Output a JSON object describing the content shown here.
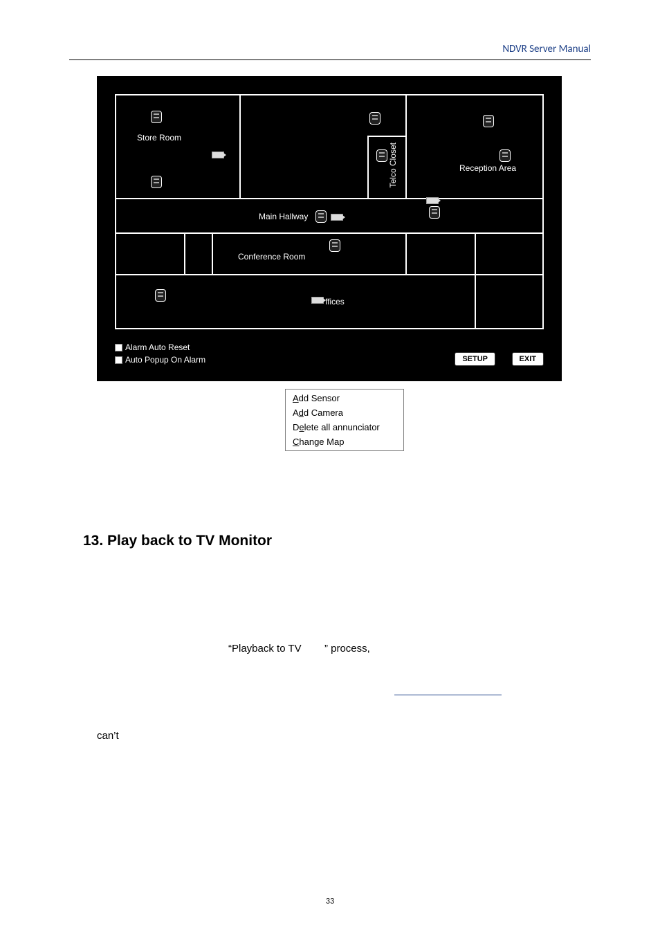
{
  "header": {
    "title": "NDVR Server Manual"
  },
  "map": {
    "rooms": {
      "store": "Store Room",
      "telco": "Telco Closet",
      "reception": "Reception Area",
      "hallway": "Main Hallway",
      "conference": "Conference Room",
      "offices": "ffices"
    },
    "checkboxes": {
      "auto_reset": "Alarm Auto Reset",
      "auto_popup": "Auto Popup On Alarm"
    },
    "buttons": {
      "setup": "SETUP",
      "exit": "EXIT"
    }
  },
  "context_menu": {
    "add_sensor": {
      "pre": "",
      "u": "A",
      "post": "dd Sensor"
    },
    "add_camera": {
      "pre": "A",
      "u": "d",
      "post": "d Camera"
    },
    "delete_all": {
      "pre": "D",
      "u": "e",
      "post": "lete all annunciator"
    },
    "change_map": {
      "pre": "",
      "u": "C",
      "post": "hange Map"
    }
  },
  "section": {
    "heading": "13. Play back to TV Monitor",
    "line1_a": "“Playback to TV",
    "line1_b": "” process,",
    "line2": "can’t"
  },
  "footer": {
    "page": "33"
  }
}
